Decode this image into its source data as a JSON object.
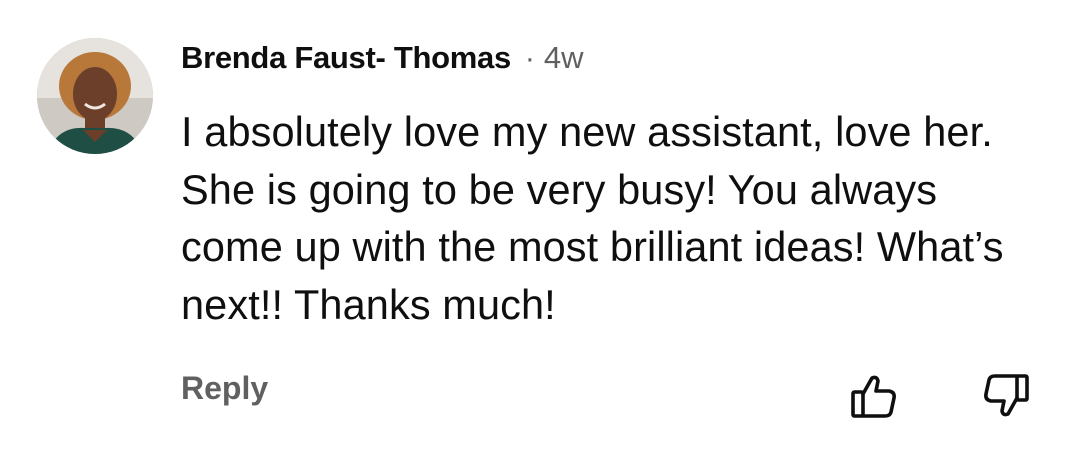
{
  "comment": {
    "author": "Brenda Faust- Thomas",
    "separator": "·",
    "time": "4w",
    "text": "I absolutely love my new assistant, love her. She is going to be very busy! You always come up with the most brilliant ideas! What’s next!! Thanks much!",
    "avatar_icon": "user-avatar-photo"
  },
  "actions": {
    "reply_label": "Reply",
    "like_icon": "thumbs-up-icon",
    "dislike_icon": "thumbs-down-icon"
  }
}
